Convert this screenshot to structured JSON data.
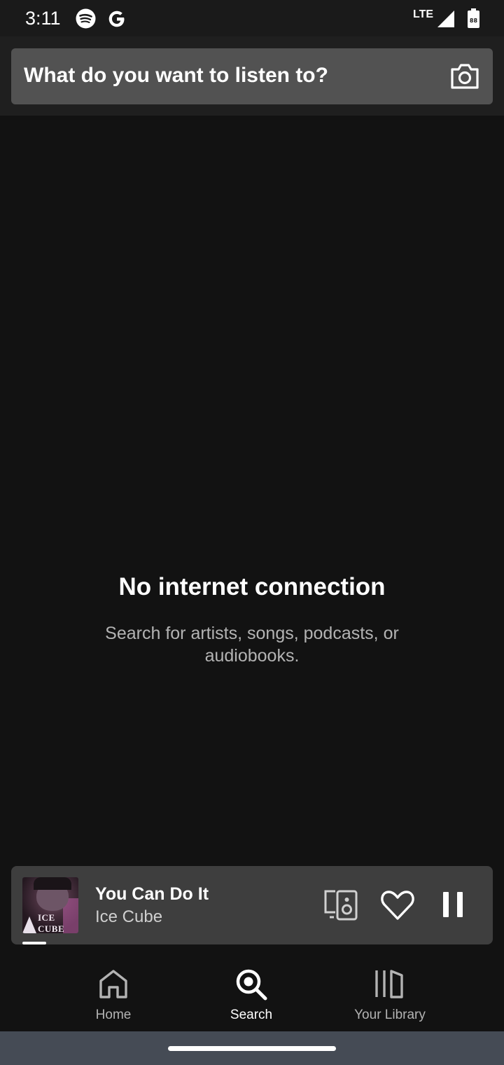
{
  "status_bar": {
    "time": "3:11",
    "network": "LTE",
    "icons": [
      "spotify-icon",
      "google-icon",
      "signal-icon",
      "battery-icon"
    ],
    "battery_text": "88"
  },
  "search": {
    "placeholder": "What do you want to listen to?",
    "camera_icon": "camera-icon"
  },
  "empty_state": {
    "title": "No internet connection",
    "subtitle": "Search for artists, songs, podcasts, or audiobooks."
  },
  "now_playing": {
    "title": "You Can Do It",
    "artist": "Ice Cube",
    "album_art_text": "ICE CUBE",
    "progress": 0.05,
    "controls": [
      "connect-device-icon",
      "heart-icon",
      "pause-icon"
    ]
  },
  "nav": {
    "items": [
      {
        "label": "Home",
        "icon": "home-icon",
        "active": false
      },
      {
        "label": "Search",
        "icon": "search-icon",
        "active": true
      },
      {
        "label": "Your Library",
        "icon": "library-icon",
        "active": false
      }
    ]
  },
  "colors": {
    "background": "#121212",
    "search_box": "#525252",
    "mini_player": "#3e3e3e",
    "secondary_text": "#b3b3b3"
  }
}
